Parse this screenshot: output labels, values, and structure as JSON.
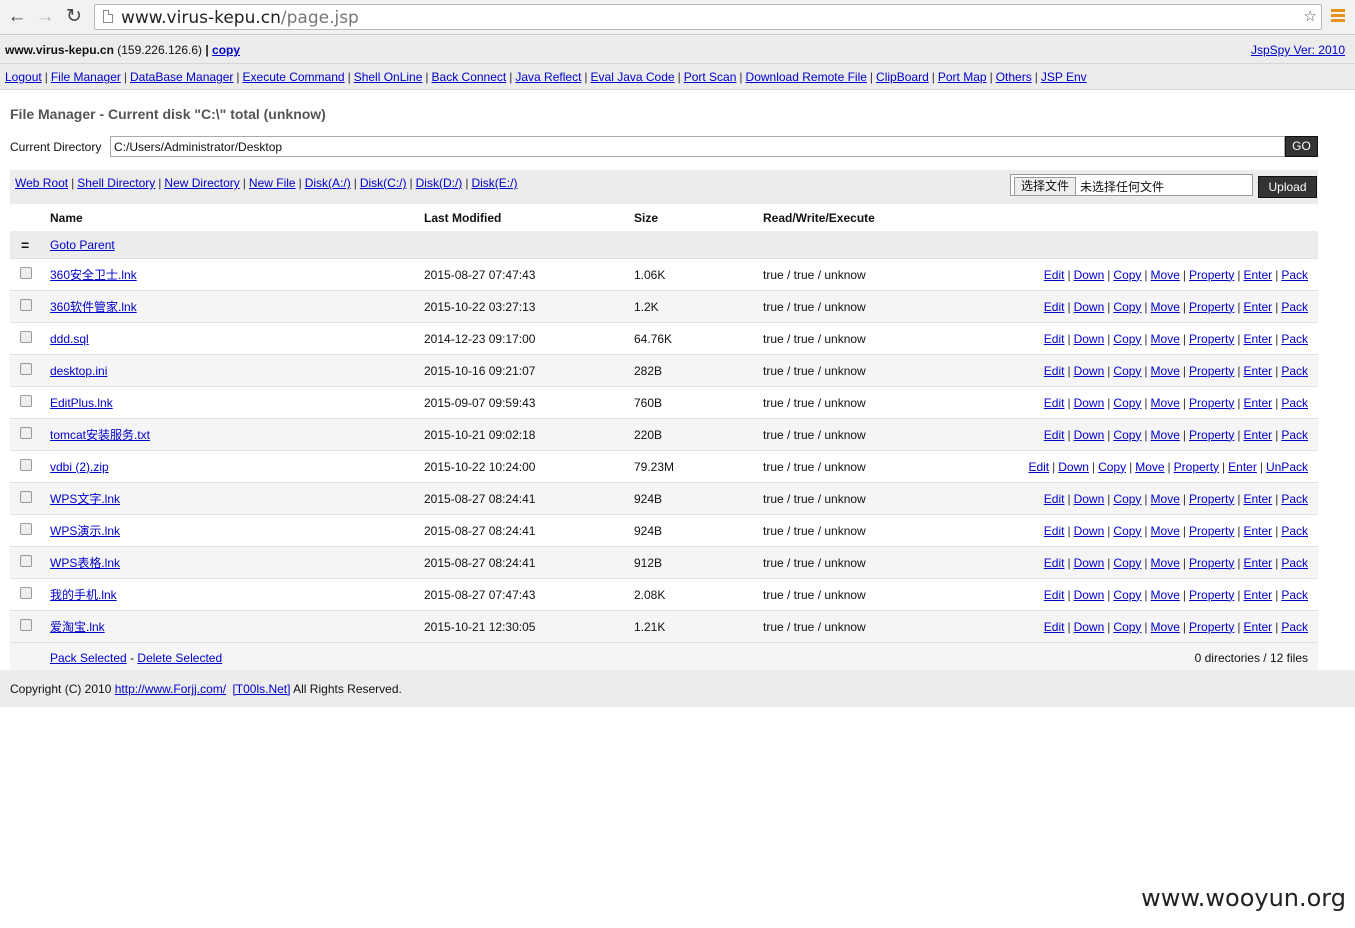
{
  "browser": {
    "url_host": "www.virus-kepu.cn",
    "url_path": "/page.jsp"
  },
  "header": {
    "host": "www.virus-kepu.cn",
    "ip": "(159.226.126.6)",
    "separator": "|",
    "copy_label": "copy",
    "version_label": "JspSpy Ver: 2010"
  },
  "nav": [
    "Logout",
    "File Manager",
    "DataBase Manager",
    "Execute Command",
    "Shell OnLine",
    "Back Connect",
    "Java Reflect",
    "Eval Java Code",
    "Port Scan",
    "Download Remote File",
    "ClipBoard",
    "Port Map",
    "Others",
    "JSP Env"
  ],
  "page_title": "File Manager - Current disk \"C:\\\" total (unknow)",
  "directory": {
    "label": "Current Directory",
    "value": "C:/Users/Administrator/Desktop",
    "go_label": "GO"
  },
  "tools": {
    "links": [
      "Web Root",
      "Shell Directory",
      "New Directory",
      "New File",
      "Disk(A:/)",
      "Disk(C:/)",
      "Disk(D:/)",
      "Disk(E:/)"
    ],
    "choose_file_label": "选择文件",
    "no_file_label": "未选择任何文件",
    "upload_label": "Upload"
  },
  "table": {
    "columns": [
      "Name",
      "Last Modified",
      "Size",
      "Read/Write/Execute"
    ],
    "parent_symbol": "=",
    "parent_label": "Goto Parent",
    "rows": [
      {
        "name": "360安全卫士.lnk",
        "modified": "2015-08-27 07:47:43",
        "size": "1.06K",
        "rwx": "true / true / unknow",
        "ops": [
          "Edit",
          "Down",
          "Copy",
          "Move",
          "Property",
          "Enter",
          "Pack"
        ]
      },
      {
        "name": "360软件管家.lnk",
        "modified": "2015-10-22 03:27:13",
        "size": "1.2K",
        "rwx": "true / true / unknow",
        "ops": [
          "Edit",
          "Down",
          "Copy",
          "Move",
          "Property",
          "Enter",
          "Pack"
        ]
      },
      {
        "name": "ddd.sql",
        "modified": "2014-12-23 09:17:00",
        "size": "64.76K",
        "rwx": "true / true / unknow",
        "ops": [
          "Edit",
          "Down",
          "Copy",
          "Move",
          "Property",
          "Enter",
          "Pack"
        ]
      },
      {
        "name": "desktop.ini",
        "modified": "2015-10-16 09:21:07",
        "size": "282B",
        "rwx": "true / true / unknow",
        "ops": [
          "Edit",
          "Down",
          "Copy",
          "Move",
          "Property",
          "Enter",
          "Pack"
        ]
      },
      {
        "name": "EditPlus.lnk",
        "modified": "2015-09-07 09:59:43",
        "size": "760B",
        "rwx": "true / true / unknow",
        "ops": [
          "Edit",
          "Down",
          "Copy",
          "Move",
          "Property",
          "Enter",
          "Pack"
        ]
      },
      {
        "name": "tomcat安装服务.txt",
        "modified": "2015-10-21 09:02:18",
        "size": "220B",
        "rwx": "true / true / unknow",
        "ops": [
          "Edit",
          "Down",
          "Copy",
          "Move",
          "Property",
          "Enter",
          "Pack"
        ]
      },
      {
        "name": "vdbi (2).zip",
        "modified": "2015-10-22 10:24:00",
        "size": "79.23M",
        "rwx": "true / true / unknow",
        "ops": [
          "Edit",
          "Down",
          "Copy",
          "Move",
          "Property",
          "Enter",
          "UnPack"
        ]
      },
      {
        "name": "WPS文字.lnk",
        "modified": "2015-08-27 08:24:41",
        "size": "924B",
        "rwx": "true / true / unknow",
        "ops": [
          "Edit",
          "Down",
          "Copy",
          "Move",
          "Property",
          "Enter",
          "Pack"
        ]
      },
      {
        "name": "WPS演示.lnk",
        "modified": "2015-08-27 08:24:41",
        "size": "924B",
        "rwx": "true / true / unknow",
        "ops": [
          "Edit",
          "Down",
          "Copy",
          "Move",
          "Property",
          "Enter",
          "Pack"
        ]
      },
      {
        "name": "WPS表格.lnk",
        "modified": "2015-08-27 08:24:41",
        "size": "912B",
        "rwx": "true / true / unknow",
        "ops": [
          "Edit",
          "Down",
          "Copy",
          "Move",
          "Property",
          "Enter",
          "Pack"
        ]
      },
      {
        "name": "我的手机.lnk",
        "modified": "2015-08-27 07:47:43",
        "size": "2.08K",
        "rwx": "true / true / unknow",
        "ops": [
          "Edit",
          "Down",
          "Copy",
          "Move",
          "Property",
          "Enter",
          "Pack"
        ]
      },
      {
        "name": "爱淘宝.lnk",
        "modified": "2015-10-21 12:30:05",
        "size": "1.21K",
        "rwx": "true / true / unknow",
        "ops": [
          "Edit",
          "Down",
          "Copy",
          "Move",
          "Property",
          "Enter",
          "Pack"
        ]
      }
    ],
    "footer": {
      "pack_selected": "Pack Selected",
      "dash": "-",
      "delete_selected": "Delete Selected",
      "summary": "0 directories / 12 files"
    }
  },
  "footer": {
    "prefix": "Copyright (C) 2010",
    "link1": "http://www.Forjj.com/",
    "link2": "[T00ls.Net]",
    "suffix": "All Rights Reserved."
  },
  "watermark": "www.wooyun.org"
}
